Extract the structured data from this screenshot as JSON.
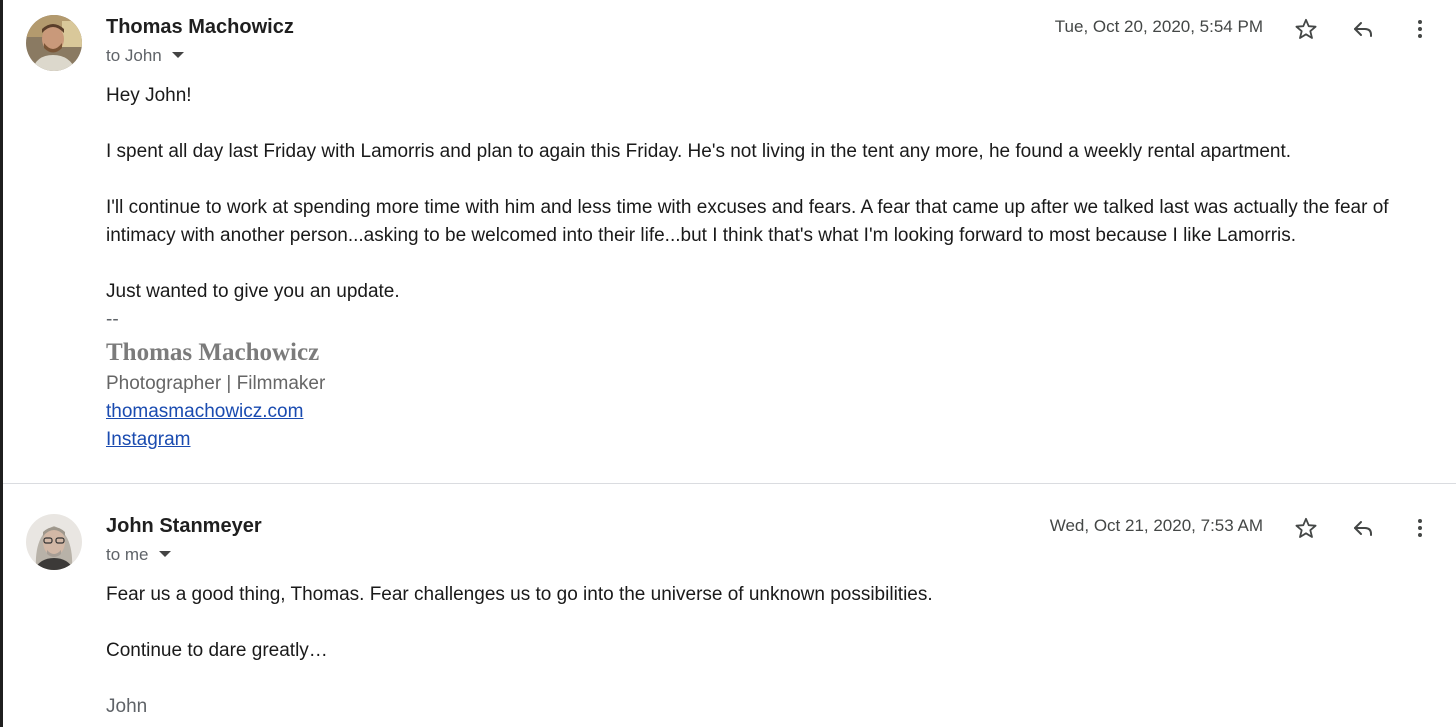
{
  "thread": [
    {
      "sender": "Thomas Machowicz",
      "recipient_line": "to John",
      "date": "Tue, Oct 20, 2020, 5:54 PM",
      "avatar": "avatar-photo-man-short-hair",
      "body": {
        "greeting": "Hey John!",
        "paragraph1": "I spent all day last Friday with Lamorris and plan to again this Friday. He's not living in the tent any more, he found a weekly rental apartment.",
        "paragraph2": "I'll continue to work at spending more time with him and less time with excuses and fears. A fear that came up after we talked last was actually the fear of intimacy with another person...asking to be welcomed into their life...but I think that's what I'm looking forward to most because I like Lamorris.",
        "paragraph3": "Just wanted to give you an update.",
        "sig_separator": "--",
        "sig_name": "Thomas Machowicz",
        "sig_role": "Photographer | Filmmaker",
        "sig_link_website": "thomasmachowicz.com",
        "sig_link_instagram": "Instagram"
      }
    },
    {
      "sender": "John Stanmeyer",
      "recipient_line": "to me",
      "date": "Wed, Oct 21, 2020, 7:53 AM",
      "avatar": "avatar-photo-man-glasses-gray-hair",
      "body": {
        "paragraph1": "Fear us a good thing, Thomas. Fear challenges us to go into the universe of unknown possibilities.",
        "paragraph2": "Continue to dare greatly…",
        "signoff": "John"
      }
    }
  ],
  "icons": {
    "star": "star-outline-icon",
    "reply": "reply-arrow-icon",
    "more": "more-vertical-icon",
    "recipient_details": "caret-down-icon"
  },
  "colors": {
    "link": "#1a4bb0",
    "divider": "#dadce0",
    "signature_name": "#7b7b7b"
  }
}
